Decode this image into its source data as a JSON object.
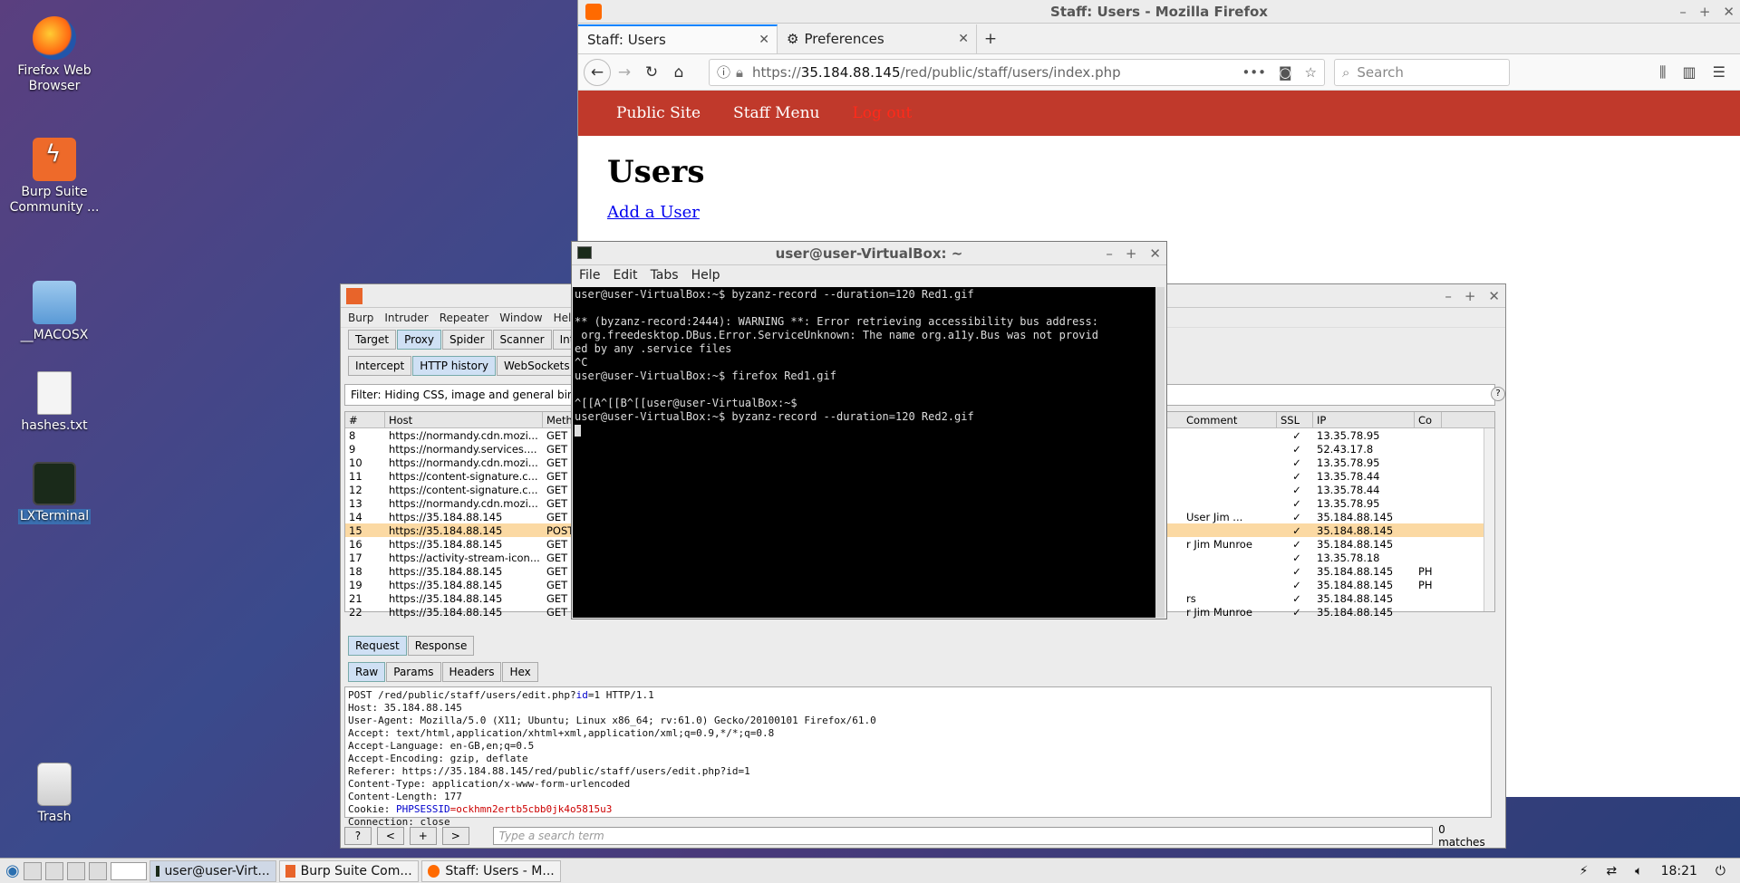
{
  "desktop": {
    "icons": [
      {
        "label": "Firefox Web Browser",
        "icon": "firefox-icon"
      },
      {
        "label": "Burp Suite Community ...",
        "icon": "burp-icon"
      },
      {
        "label": "__MACOSX",
        "icon": "folder-icon"
      },
      {
        "label": "hashes.txt",
        "icon": "text-file-icon"
      },
      {
        "label": "LXTerminal",
        "icon": "terminal-icon"
      },
      {
        "label": "Trash",
        "icon": "trash-icon"
      }
    ]
  },
  "firefox": {
    "title": "Staff: Users - Mozilla Firefox",
    "tabs": [
      {
        "label": "Staff: Users"
      },
      {
        "label": "Preferences"
      }
    ],
    "url_prefix": "https://",
    "url_host": "35.184.88.145",
    "url_path": "/red/public/staff/users/index.php",
    "search_placeholder": "Search",
    "nav": {
      "public": "Public Site",
      "staff": "Staff Menu",
      "logout": "Log out"
    },
    "heading": "Users",
    "add_link": "Add a User"
  },
  "terminal": {
    "title": "user@user-VirtualBox: ~",
    "menu": [
      "File",
      "Edit",
      "Tabs",
      "Help"
    ],
    "lines": [
      "user@user-VirtualBox:~$ byzanz-record --duration=120 Red1.gif",
      "",
      "** (byzanz-record:2444): WARNING **: Error retrieving accessibility bus address:",
      " org.freedesktop.DBus.Error.ServiceUnknown: The name org.a11y.Bus was not provid",
      "ed by any .service files",
      "^C",
      "user@user-VirtualBox:~$ firefox Red1.gif",
      "",
      "^[[A^[[B^[[user@user-VirtualBox:~$",
      "user@user-VirtualBox:~$ byzanz-record --duration=120 Red2.gif"
    ]
  },
  "burp": {
    "menu": [
      "Burp",
      "Intruder",
      "Repeater",
      "Window",
      "Help"
    ],
    "tabs1": [
      "Target",
      "Proxy",
      "Spider",
      "Scanner",
      "Intr"
    ],
    "tabs2": [
      "Intercept",
      "HTTP history",
      "WebSockets hi"
    ],
    "filter": "Filter: Hiding CSS, image and general binar",
    "columns": {
      "num": "#",
      "host": "Host",
      "method": "Meth",
      "comment": "Comment",
      "ssl": "SSL",
      "ip": "IP",
      "co": "Co"
    },
    "rows": [
      {
        "num": "8",
        "host": "https://normandy.cdn.mozi...",
        "method": "GET",
        "comment": "",
        "ssl": "✓",
        "ip": "13.35.78.95",
        "co": ""
      },
      {
        "num": "9",
        "host": "https://normandy.services....",
        "method": "GET",
        "comment": "",
        "ssl": "✓",
        "ip": "52.43.17.8",
        "co": ""
      },
      {
        "num": "10",
        "host": "https://normandy.cdn.mozi...",
        "method": "GET",
        "comment": "",
        "ssl": "✓",
        "ip": "13.35.78.95",
        "co": ""
      },
      {
        "num": "11",
        "host": "https://content-signature.c...",
        "method": "GET",
        "comment": "",
        "ssl": "✓",
        "ip": "13.35.78.44",
        "co": ""
      },
      {
        "num": "12",
        "host": "https://content-signature.c...",
        "method": "GET",
        "comment": "",
        "ssl": "✓",
        "ip": "13.35.78.44",
        "co": ""
      },
      {
        "num": "13",
        "host": "https://normandy.cdn.mozi...",
        "method": "GET",
        "comment": "",
        "ssl": "✓",
        "ip": "13.35.78.95",
        "co": ""
      },
      {
        "num": "14",
        "host": "https://35.184.88.145",
        "method": "GET",
        "comment": "User Jim ...",
        "ssl": "✓",
        "ip": "35.184.88.145",
        "co": ""
      },
      {
        "num": "15",
        "host": "https://35.184.88.145",
        "method": "POST",
        "comment": "",
        "ssl": "✓",
        "ip": "35.184.88.145",
        "co": ""
      },
      {
        "num": "16",
        "host": "https://35.184.88.145",
        "method": "GET",
        "comment": "r Jim Munroe",
        "ssl": "✓",
        "ip": "35.184.88.145",
        "co": ""
      },
      {
        "num": "17",
        "host": "https://activity-stream-icon...",
        "method": "GET",
        "comment": "",
        "ssl": "✓",
        "ip": "13.35.78.18",
        "co": ""
      },
      {
        "num": "18",
        "host": "https://35.184.88.145",
        "method": "GET",
        "comment": "",
        "ssl": "✓",
        "ip": "35.184.88.145",
        "co": "PH"
      },
      {
        "num": "19",
        "host": "https://35.184.88.145",
        "method": "GET",
        "comment": "",
        "ssl": "✓",
        "ip": "35.184.88.145",
        "co": "PH"
      },
      {
        "num": "21",
        "host": "https://35.184.88.145",
        "method": "GET",
        "comment": "rs",
        "ssl": "✓",
        "ip": "35.184.88.145",
        "co": ""
      },
      {
        "num": "22",
        "host": "https://35.184.88.145",
        "method": "GET",
        "comment": "r Jim Munroe",
        "ssl": "✓",
        "ip": "35.184.88.145",
        "co": ""
      }
    ],
    "req_tabs": [
      "Request",
      "Response"
    ],
    "raw_tabs": [
      "Raw",
      "Params",
      "Headers",
      "Hex"
    ],
    "raw_line1_a": "POST /red/public/staff/users/edit.php?",
    "raw_line1_k": "id",
    "raw_line1_b": "=1 HTTP/1.1",
    "raw_lines": [
      "Host: 35.184.88.145",
      "User-Agent: Mozilla/5.0 (X11; Ubuntu; Linux x86_64; rv:61.0) Gecko/20100101 Firefox/61.0",
      "Accept: text/html,application/xhtml+xml,application/xml;q=0.9,*/*;q=0.8",
      "Accept-Language: en-GB,en;q=0.5",
      "Accept-Encoding: gzip, deflate",
      "Referer: https://35.184.88.145/red/public/staff/users/edit.php?id=1",
      "Content-Type: application/x-www-form-urlencoded",
      "Content-Length: 177"
    ],
    "cookie_label": "Cookie: ",
    "cookie_key": "PHPSESSID",
    "cookie_val": "=ockhmn2ertb5cbb0jk4o5815u3",
    "raw_last": "Connection: close",
    "search_placeholder": "Type a search term",
    "matches": "0 matches",
    "help_btn": "?",
    "prev_btn": "<",
    "add_btn": "+",
    "next_btn": ">"
  },
  "taskbar": {
    "items": [
      "user@user-Virt...",
      "Burp Suite Com...",
      "Staff: Users - M..."
    ],
    "clock": "18:21"
  }
}
